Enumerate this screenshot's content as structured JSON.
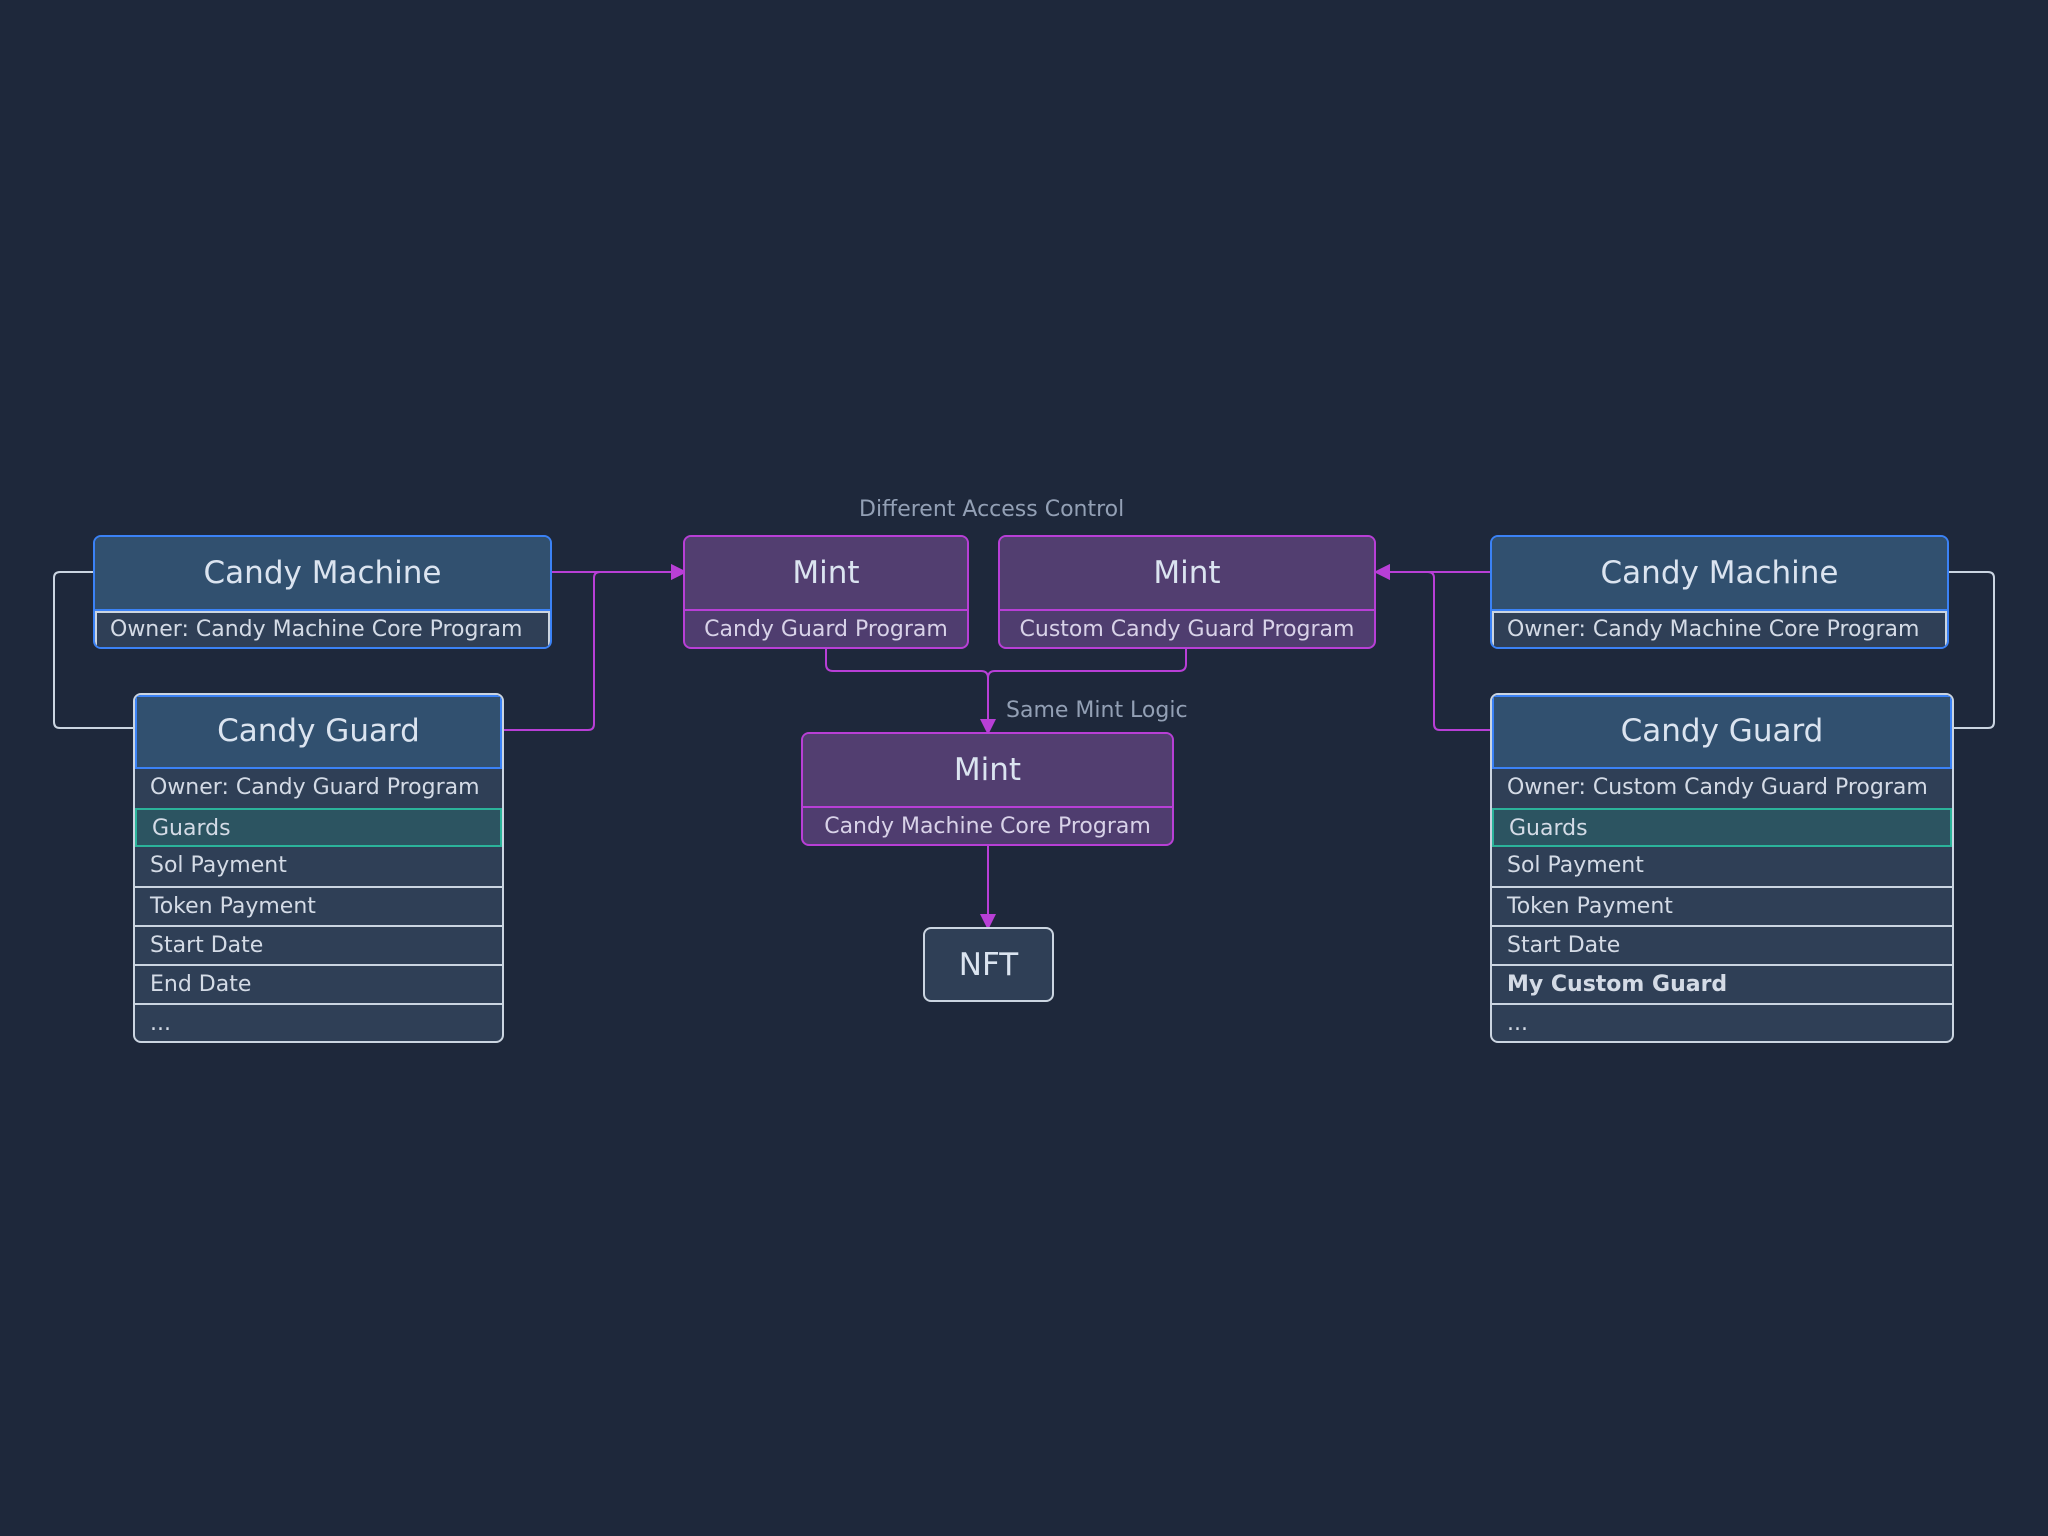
{
  "labels": {
    "access_control": "Different Access Control",
    "same_mint_logic": "Same Mint Logic"
  },
  "left": {
    "candy_machine": {
      "title": "Candy Machine",
      "owner": "Owner: Candy Machine Core Program"
    },
    "candy_guard": {
      "title": "Candy Guard",
      "owner": "Owner: Candy Guard Program",
      "guards_header": "Guards",
      "guards": [
        "Sol Payment",
        "Token Payment",
        "Start Date",
        "End Date",
        "..."
      ]
    }
  },
  "right": {
    "candy_machine": {
      "title": "Candy Machine",
      "owner": "Owner: Candy Machine Core Program"
    },
    "candy_guard": {
      "title": "Candy Guard",
      "owner": "Owner: Custom Candy Guard Program",
      "guards_header": "Guards",
      "guards": [
        "Sol Payment",
        "Token Payment",
        "Start Date",
        "My Custom Guard",
        "..."
      ]
    }
  },
  "mint_left": {
    "title": "Mint",
    "program": "Candy Guard Program"
  },
  "mint_right": {
    "title": "Mint",
    "program": "Custom Candy Guard Program"
  },
  "mint_core": {
    "title": "Mint",
    "program": "Candy Machine Core Program"
  },
  "nft": {
    "title": "NFT"
  },
  "colors": {
    "background": "#1e283b",
    "account_border": "#3b82f6",
    "instruction_border": "#b83fd6",
    "guards_highlight": "#2bb39a",
    "neutral_line": "#cbd5e1"
  }
}
